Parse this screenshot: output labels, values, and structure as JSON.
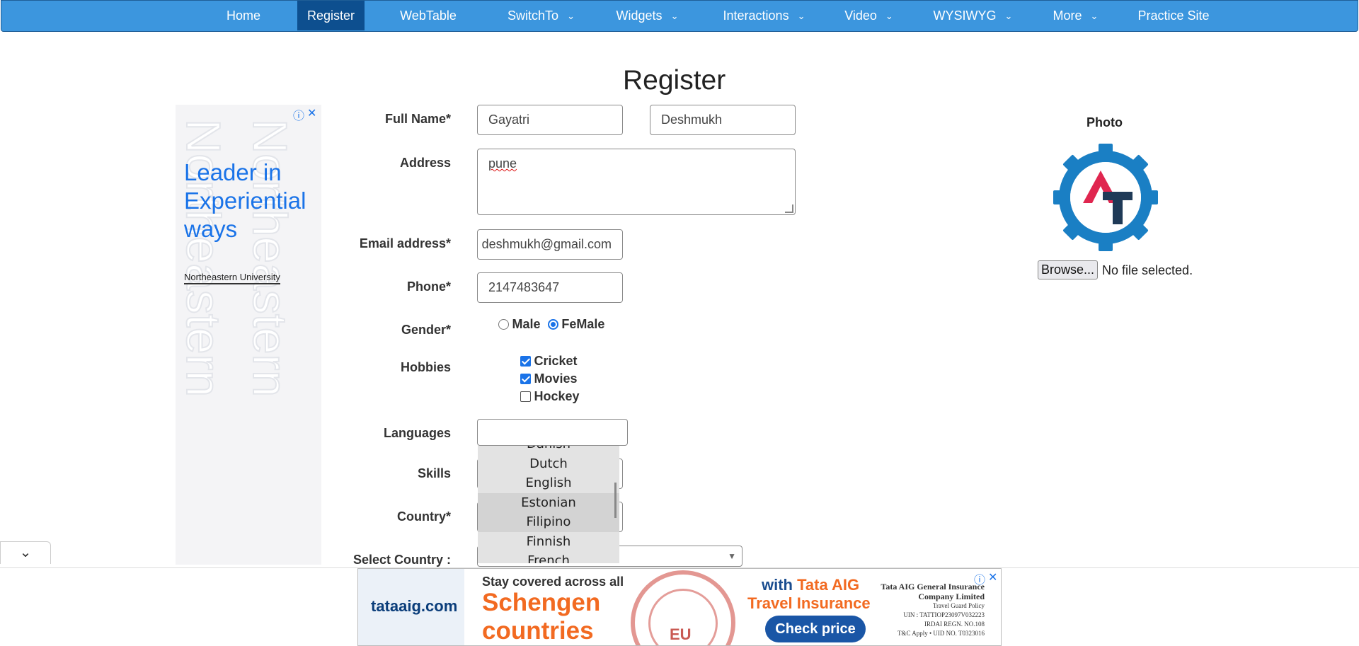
{
  "nav": {
    "items": [
      {
        "label": "Home",
        "dropdown": false,
        "active": false
      },
      {
        "label": "Register",
        "dropdown": false,
        "active": true
      },
      {
        "label": "WebTable",
        "dropdown": false,
        "active": false
      },
      {
        "label": "SwitchTo",
        "dropdown": true,
        "active": false
      },
      {
        "label": "Widgets",
        "dropdown": true,
        "active": false
      },
      {
        "label": "Interactions",
        "dropdown": true,
        "active": false
      },
      {
        "label": "Video",
        "dropdown": true,
        "active": false
      },
      {
        "label": "WYSIWYG",
        "dropdown": true,
        "active": false
      },
      {
        "label": "More",
        "dropdown": true,
        "active": false
      },
      {
        "label": "Practice Site",
        "dropdown": false,
        "active": false
      }
    ]
  },
  "page": {
    "title": "Register"
  },
  "form": {
    "full_name_label": "Full Name*",
    "first_name": "Gayatri",
    "last_name": "Deshmukh",
    "address_label": "Address",
    "address": "pune",
    "email_label": "Email address*",
    "email": "deshmukh@gmail.com",
    "phone_label": "Phone*",
    "phone": "2147483647",
    "gender_label": "Gender*",
    "gender_options": [
      {
        "label": "Male",
        "checked": false
      },
      {
        "label": "FeMale",
        "checked": true
      }
    ],
    "hobbies_label": "Hobbies",
    "hobbies": [
      {
        "label": "Cricket",
        "checked": true
      },
      {
        "label": "Movies",
        "checked": true
      },
      {
        "label": "Hockey",
        "checked": false
      }
    ],
    "languages_label": "Languages",
    "languages_value": "",
    "languages_dropdown": [
      "Danish",
      "Dutch",
      "English",
      "Estonian",
      "Filipino",
      "Finnish",
      "French"
    ],
    "skills_label": "Skills",
    "country_label": "Country*",
    "select_country_label": "Select Country :"
  },
  "photo": {
    "title": "Photo",
    "browse_label": "Browse...",
    "file_status": "No file selected."
  },
  "ad_left": {
    "headline": "Leader in Experiential ways",
    "brand": "Northeastern University",
    "watermark": "Northeastern"
  },
  "ad_bottom": {
    "logo": "tataaig.com",
    "tagline": "Stay covered across all",
    "headline": "Schengen countries",
    "stamp_text": "EU",
    "with_text": "with",
    "brand_text": "Tata AIG",
    "product": "Travel Insurance",
    "cta": "Check price",
    "fine_title": "Tata AIG General Insurance Company Limited",
    "fine_lines": [
      "Travel Guard Policy",
      "UIN : TATTIOP23097V032223",
      "IRDAI REGN. NO.108",
      "T&C Apply • UID NO. T0323016"
    ]
  },
  "icons": {
    "collapse": "chevron-down-icon",
    "ad_info": "info-icon",
    "ad_close": "close-icon",
    "logo": "gear-logo-icon"
  },
  "colors": {
    "nav_bg": "#3c96de",
    "nav_active": "#0d4f8f",
    "accent": "#1a73e8",
    "ad_orange": "#f26a21"
  }
}
